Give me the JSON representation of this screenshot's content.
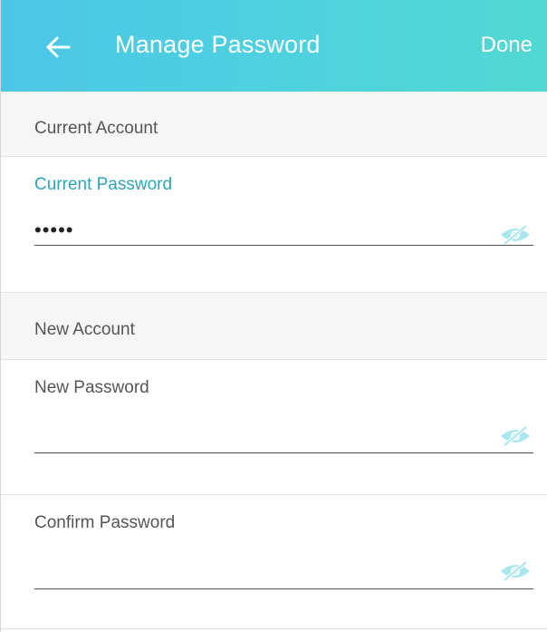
{
  "header": {
    "title": "Manage Password",
    "done_label": "Done",
    "back_icon": "arrow-left-icon",
    "gradient_colors": [
      "#4cc6e6",
      "#52d8d2"
    ]
  },
  "sections": [
    {
      "title": "Current Account",
      "fields": [
        {
          "label": "Current Password",
          "value": "•••••",
          "focused": true,
          "toggle_icon": "eye-hidden-icon"
        }
      ]
    },
    {
      "title": "New Account",
      "fields": [
        {
          "label": "New Password",
          "value": "",
          "focused": false,
          "toggle_icon": "eye-hidden-icon"
        },
        {
          "label": "Confirm Password",
          "value": "",
          "focused": false,
          "toggle_icon": "eye-hidden-icon"
        }
      ]
    }
  ],
  "colors": {
    "accent": "#2da4b8",
    "icon_tint": "#a9e6ee",
    "section_bg": "#f6f6f6"
  }
}
